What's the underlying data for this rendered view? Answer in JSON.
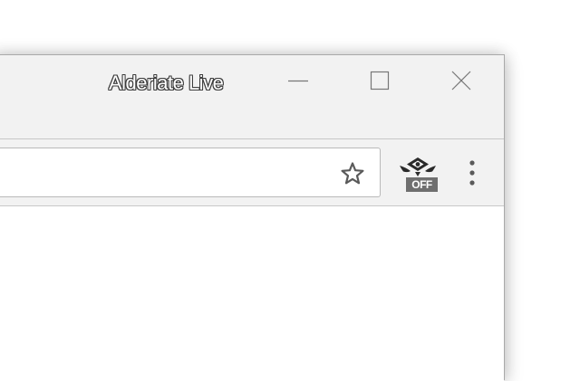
{
  "window": {
    "title": "Alderiate Live"
  },
  "titlebar_buttons": {
    "minimize_icon": "minimize-icon",
    "maximize_icon": "maximize-icon",
    "close_icon": "close-icon"
  },
  "toolbar": {
    "address_value": "",
    "bookmark_icon": "star-icon",
    "extension": {
      "icon": "winged-eye-icon",
      "badge": "OFF"
    },
    "menu_icon": "vertical-dots-icon"
  },
  "colors": {
    "chrome_background": "#f2f2f2",
    "border": "#c8c8c8",
    "badge_background": "#6f6f6f",
    "icon_gray": "#5a5a5a"
  }
}
